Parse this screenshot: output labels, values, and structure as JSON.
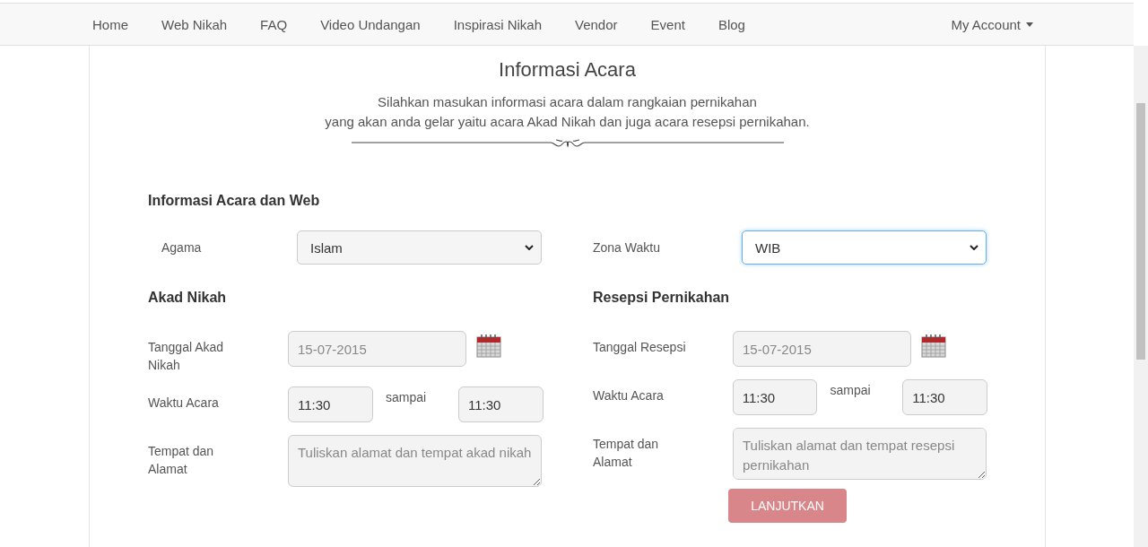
{
  "nav": {
    "items": [
      {
        "label": "Home",
        "selected": false
      },
      {
        "label": "Web Nikah",
        "selected": false
      },
      {
        "label": "FAQ",
        "selected": false
      },
      {
        "label": "Video Undangan",
        "selected": false
      },
      {
        "label": "Inspirasi Nikah",
        "selected": false
      },
      {
        "label": "Vendor",
        "selected": false
      },
      {
        "label": "Event",
        "selected": false
      },
      {
        "label": "Blog",
        "selected": false
      }
    ],
    "account": {
      "label": "My Account"
    }
  },
  "header": {
    "title": "Informasi Acara",
    "subtitle": [
      "Silahkan masukan informasi acara dalam rangkaian pernikahan",
      "yang akan anda gelar yaitu acara Akad Nikah dan juga acara resepsi pernikahan."
    ]
  },
  "section_title": "Informasi Acara dan Web",
  "selects": [
    {
      "label": "Agama",
      "value": "Islam",
      "focused": false
    },
    {
      "label": "Zona Waktu",
      "value": "WIB",
      "focused": true
    }
  ],
  "events": [
    {
      "heading": "Akad Nikah",
      "date_label": "Tanggal Akad Nikah",
      "date_value": "15-07-2015",
      "time_label": "Waktu Acara",
      "time_from": "11:30",
      "between": "sampai",
      "time_to": "11:30",
      "place_label": "Tempat dan Alamat",
      "place_placeholder": "Tuliskan alamat dan tempat akad nikah"
    },
    {
      "heading": "Resepsi Pernikahan",
      "date_label": "Tanggal Resepsi",
      "date_value": "15-07-2015",
      "time_label": "Waktu Acara",
      "time_from": "11:30",
      "between": "sampai",
      "time_to": "11:30",
      "place_label": "Tempat dan Alamat",
      "place_placeholder": "Tuliskan alamat dan tempat resepsi pernikahan"
    }
  ],
  "submit": {
    "label": "LANJUTKAN"
  }
}
